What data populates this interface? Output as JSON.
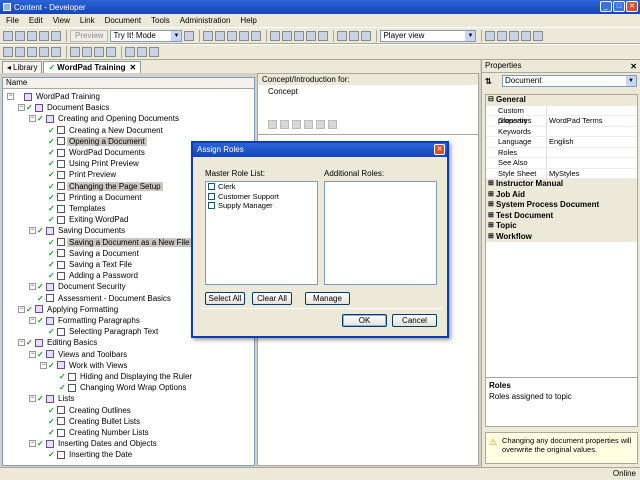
{
  "window": {
    "title": "Content - Developer"
  },
  "menu": [
    "File",
    "Edit",
    "View",
    "Link",
    "Document",
    "Tools",
    "Administration",
    "Help"
  ],
  "toolbar": {
    "preview_label": "Preview",
    "tryit_mode": "Try It! Mode",
    "player_view": "Player view"
  },
  "tabs": [
    {
      "label": "Library"
    },
    {
      "label": "WordPad Training"
    }
  ],
  "tree": {
    "header": "Name",
    "nodes": [
      {
        "label": "WordPad Training",
        "level": 0,
        "icon": "module",
        "check": false,
        "selected": false
      },
      {
        "label": "Document Basics",
        "level": 1,
        "icon": "section",
        "check": true,
        "selected": false
      },
      {
        "label": "Creating and Opening Documents",
        "level": 2,
        "icon": "section",
        "check": true,
        "selected": false
      },
      {
        "label": "Creating a New Document",
        "level": 3,
        "icon": "doc",
        "check": true,
        "selected": false
      },
      {
        "label": "Opening a Document",
        "level": 3,
        "icon": "doc",
        "check": true,
        "selected": true
      },
      {
        "label": "WordPad Documents",
        "level": 3,
        "icon": "doc",
        "check": true,
        "selected": false
      },
      {
        "label": "Using Print Preview",
        "level": 3,
        "icon": "doc",
        "check": true,
        "selected": false
      },
      {
        "label": "Print Preview",
        "level": 3,
        "icon": "doc",
        "check": true,
        "selected": false
      },
      {
        "label": "Changing the Page Setup",
        "level": 3,
        "icon": "doc",
        "check": true,
        "selected": true
      },
      {
        "label": "Printing a Document",
        "level": 3,
        "icon": "doc",
        "check": true,
        "selected": false
      },
      {
        "label": "Templates",
        "level": 3,
        "icon": "doc",
        "check": true,
        "selected": false
      },
      {
        "label": "Exiting WordPad",
        "level": 3,
        "icon": "doc",
        "check": true,
        "selected": false
      },
      {
        "label": "Saving Documents",
        "level": 2,
        "icon": "section",
        "check": true,
        "selected": false
      },
      {
        "label": "Saving a Document as a New File",
        "level": 3,
        "icon": "doc",
        "check": true,
        "selected": true
      },
      {
        "label": "Saving a Document",
        "level": 3,
        "icon": "doc",
        "check": true,
        "selected": false
      },
      {
        "label": "Saving a Text File",
        "level": 3,
        "icon": "doc",
        "check": true,
        "selected": false
      },
      {
        "label": "Adding a Password",
        "level": 3,
        "icon": "doc",
        "check": true,
        "selected": false
      },
      {
        "label": "Document Security",
        "level": 2,
        "icon": "section",
        "check": true,
        "selected": false
      },
      {
        "label": "Assessment - Document Basics",
        "level": 2,
        "icon": "doc",
        "check": true,
        "selected": false
      },
      {
        "label": "Applying Formatting",
        "level": 1,
        "icon": "section",
        "check": true,
        "selected": false
      },
      {
        "label": "Formatting Paragraphs",
        "level": 2,
        "icon": "section",
        "check": true,
        "selected": false
      },
      {
        "label": "Selecting Paragraph Text",
        "level": 3,
        "icon": "doc",
        "check": true,
        "selected": false
      },
      {
        "label": "Editing Basics",
        "level": 1,
        "icon": "section",
        "check": true,
        "selected": false
      },
      {
        "label": "Views and Toolbars",
        "level": 2,
        "icon": "section",
        "check": true,
        "selected": false
      },
      {
        "label": "Work with Views",
        "level": 3,
        "icon": "section",
        "check": true,
        "selected": false
      },
      {
        "label": "Hiding and Displaying the Ruler",
        "level": 4,
        "icon": "doc",
        "check": true,
        "selected": false
      },
      {
        "label": "Changing Word Wrap Options",
        "level": 4,
        "icon": "doc",
        "check": true,
        "selected": false
      },
      {
        "label": "Lists",
        "level": 2,
        "icon": "section",
        "check": true,
        "selected": false
      },
      {
        "label": "Creating Outlines",
        "level": 3,
        "icon": "doc",
        "check": true,
        "selected": false
      },
      {
        "label": "Creating Bullet Lists",
        "level": 3,
        "icon": "doc",
        "check": true,
        "selected": false
      },
      {
        "label": "Creating Number Lists",
        "level": 3,
        "icon": "doc",
        "check": true,
        "selected": false
      },
      {
        "label": "Inserting Dates and Objects",
        "level": 2,
        "icon": "section",
        "check": true,
        "selected": false
      },
      {
        "label": "Inserting the Date",
        "level": 3,
        "icon": "doc",
        "check": true,
        "selected": false
      }
    ]
  },
  "center": {
    "header": "Concept/Introduction for:",
    "concept": "Concept"
  },
  "properties": {
    "title": "Properties",
    "combo": "Document",
    "general_label": "General",
    "general": [
      {
        "k": "Custom properties",
        "v": ""
      },
      {
        "k": "Glossary",
        "v": "WordPad Terms"
      },
      {
        "k": "Keywords",
        "v": ""
      },
      {
        "k": "Language",
        "v": "English"
      },
      {
        "k": "Roles",
        "v": ""
      },
      {
        "k": "See Also",
        "v": ""
      },
      {
        "k": "Style Sheet",
        "v": "MyStyles"
      }
    ],
    "categories": [
      "Instructor Manual",
      "Job Aid",
      "System Process Document",
      "Test Document",
      "Topic",
      "Workflow"
    ],
    "desc_title": "Roles",
    "desc_text": "Roles assigned to topic",
    "warning": "Changing any document properties will overwrite the original values."
  },
  "dialog": {
    "title": "Assign Roles",
    "master_label": "Master Role List:",
    "additional_label": "Additional Roles:",
    "roles": [
      "Clerk",
      "Customer Support",
      "Supply Manager"
    ],
    "select_all": "Select All",
    "clear_all": "Clear All",
    "manage": "Manage",
    "ok": "OK",
    "cancel": "Cancel"
  },
  "status": {
    "online": "Online"
  }
}
